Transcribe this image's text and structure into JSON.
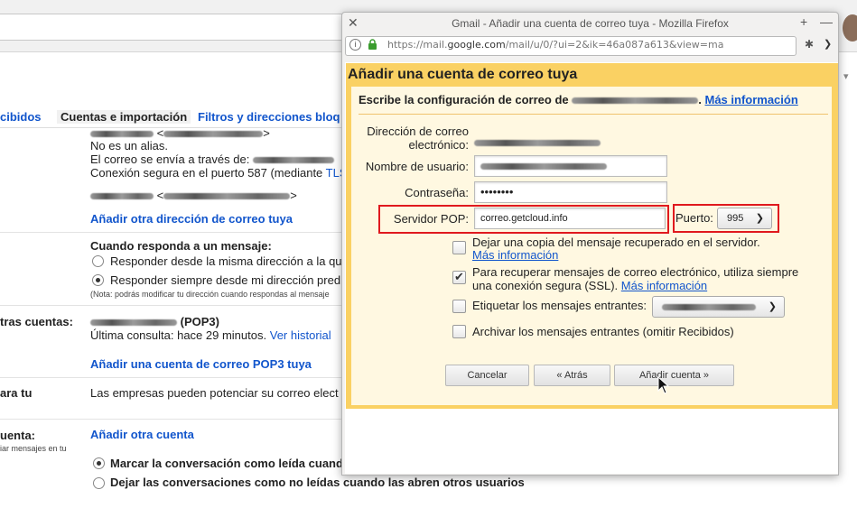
{
  "background": {
    "tabs": [
      "cibidos",
      "Cuentas e importación",
      "Filtros y direcciones bloq"
    ],
    "alias_line": "No es un alias.",
    "send_via": "El correo se envía a través de:",
    "secure_conn": "Conexión segura en el puerto 587 (mediante ",
    "tls": "TLS",
    "add_address": "Añadir otra dirección de correo tuya",
    "reply_heading": "Cuando responda a un mensaje:",
    "reply_opt1": "Responder desde la misma dirección a la qu",
    "reply_opt2": "Responder siempre desde mi dirección pred",
    "reply_note": "(Nota: podrás modificar tu dirección cuando respondas al mensaje",
    "other_accounts_label": "tras cuentas:",
    "pop3_suffix": "(POP3)",
    "last_check": "Última consulta: hace 29 minutos.",
    "history_link": "Ver historial",
    "add_pop3": "Añadir una cuenta de correo POP3 tuya",
    "ara_tu": "ara tu",
    "companies": "Las empresas pueden potenciar su correo elect",
    "cuenta_label": "uenta:",
    "add_other": "Añadir otra cuenta",
    "cuenta_small": "iar mensajes en tu",
    "mark_read": "Marcar la conversación como leída cuand",
    "leave_unread": "Dejar las conversaciones como no leídas cuando las abren otros usuarios"
  },
  "window": {
    "title": "Gmail - Añadir una cuenta de correo tuya - Mozilla Firefox",
    "url_prefix": "https://mail.",
    "url_domain": "google.com",
    "url_rest": "/mail/u/0/?ui=2&ik=46a087a613&view=ma"
  },
  "dialog": {
    "heading": "Añadir una cuenta de correo tuya",
    "subtitle": "Escribe la configuración de correo de",
    "more_info": "Más información",
    "email_label_1": "Dirección de correo",
    "email_label_2": "electrónico:",
    "username_label": "Nombre de usuario:",
    "password_label": "Contraseña:",
    "password_value": "••••••••",
    "pop_label": "Servidor POP:",
    "pop_value": "correo.getcloud.info",
    "port_label": "Puerto:",
    "port_value": "995",
    "leave_copy": "Dejar una copia del mensaje recuperado en el servidor.",
    "leave_copy_link": "Más información",
    "ssl_text_1": "Para recuperar mensajes de correo electrónico, utiliza siempre",
    "ssl_text_2": "una conexión segura (SSL).",
    "ssl_link": "Más información",
    "label_incoming": "Etiquetar los mensajes entrantes:",
    "archive_incoming": "Archivar los mensajes entrantes (omitir Recibidos)",
    "cancel": "Cancelar",
    "back": "« Atrás",
    "add_account": "Añadir cuenta »"
  },
  "state": {
    "leave_copy_checked": false,
    "ssl_checked": true,
    "label_checked": false,
    "archive_checked": false
  }
}
